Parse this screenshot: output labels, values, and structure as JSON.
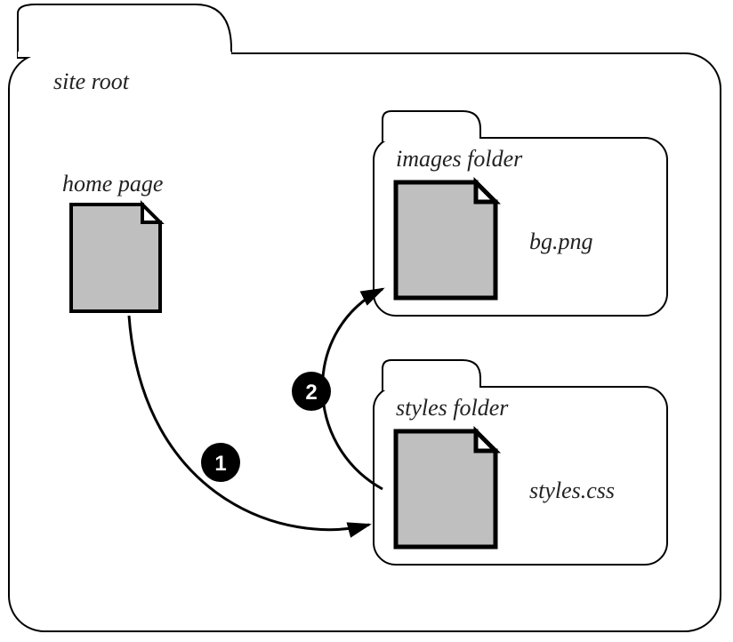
{
  "root": {
    "label": "site root"
  },
  "home": {
    "label": "home page"
  },
  "images_folder": {
    "label": "images folder",
    "file": "bg.png"
  },
  "styles_folder": {
    "label": "styles folder",
    "file": "styles.css"
  },
  "arrows": {
    "one": "1",
    "two": "2"
  }
}
